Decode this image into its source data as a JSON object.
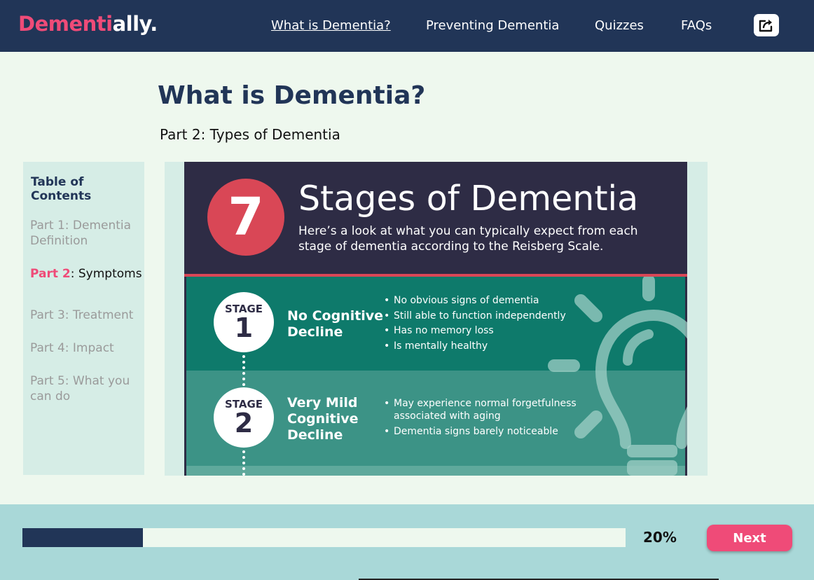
{
  "brand": {
    "logo_part1": "Dementi",
    "logo_part2": "ally."
  },
  "nav": {
    "items": [
      {
        "label": "What is Dementia?",
        "active": true
      },
      {
        "label": "Preventing Dementia",
        "active": false
      },
      {
        "label": "Quizzes",
        "active": false
      },
      {
        "label": "FAQs",
        "active": false
      }
    ],
    "share_icon": "share-icon"
  },
  "page": {
    "title": "What is Dementia?",
    "subtitle": "Part 2: Types of Dementia"
  },
  "toc": {
    "heading": "Table of Contents",
    "items": [
      {
        "label": "Part 1: Dementia Definition"
      },
      {
        "label_prefix": "Part 2",
        "label_rest": ": Symptoms",
        "current": true
      },
      {
        "label": "Part 3: Treatment"
      },
      {
        "label": "Part 4: Impact"
      },
      {
        "label": "Part 5: What you can do"
      }
    ]
  },
  "infographic": {
    "number": "7",
    "title": "Stages of Dementia",
    "description": "Here’s a look at what you can typically expect from each stage of dementia according to the Reisberg Scale.",
    "stages": [
      {
        "label": "STAGE",
        "number": "1",
        "name_lines": [
          "No Cognitive",
          "Decline"
        ],
        "bullets": [
          "No obvious signs of dementia",
          "Still able to function independently",
          "Has no memory loss",
          "Is mentally healthy"
        ]
      },
      {
        "label": "STAGE",
        "number": "2",
        "name_lines": [
          "Very Mild",
          "Cognitive",
          "Decline"
        ],
        "bullets": [
          [
            "May experience normal forgetfulness",
            "associated with aging"
          ],
          "Dementia signs barely noticeable"
        ]
      }
    ],
    "colors": {
      "dark": "#2e2c45",
      "red": "#d94756",
      "teal1": "#0e7a6b",
      "teal2": "#3c9386"
    }
  },
  "progress": {
    "value": 0.2,
    "label": "20%"
  },
  "next_button": {
    "label": "Next"
  },
  "colors": {
    "navy": "#213557",
    "pink": "#ef4b78",
    "mint_bg": "#eef8ee",
    "panel": "#d6ede6",
    "footer": "#a9d8d8"
  }
}
